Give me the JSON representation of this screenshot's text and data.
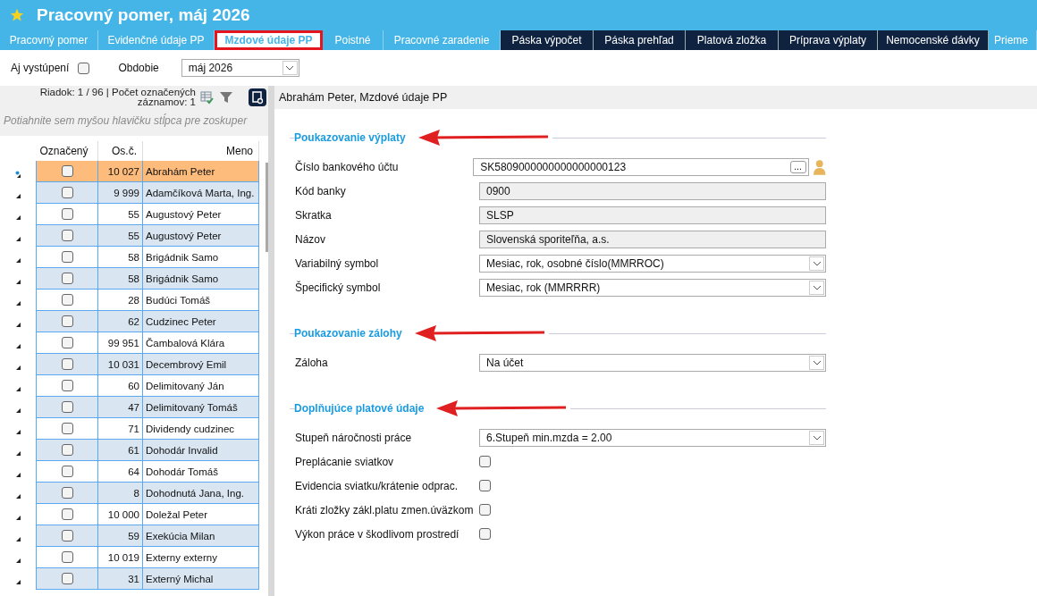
{
  "window": {
    "title": "Pracovný pomer, máj 2026"
  },
  "tabs": [
    {
      "label": "Pracovný pomer",
      "kind": "light",
      "selected": false
    },
    {
      "label": "Evidenčné údaje PP",
      "kind": "light",
      "selected": false
    },
    {
      "label": "Mzdové údaje PP",
      "kind": "light",
      "selected": true
    },
    {
      "label": "Poistné",
      "kind": "light",
      "selected": false
    },
    {
      "label": "Pracovné zaradenie",
      "kind": "light",
      "selected": false
    },
    {
      "label": "Páska výpočet",
      "kind": "dark",
      "selected": false
    },
    {
      "label": "Páska prehľad",
      "kind": "dark",
      "selected": false
    },
    {
      "label": "Platová zložka",
      "kind": "dark",
      "selected": false
    },
    {
      "label": "Príprava výplaty",
      "kind": "dark",
      "selected": false
    },
    {
      "label": "Nemocenské dávky",
      "kind": "dark",
      "selected": false
    },
    {
      "label": "Prieme",
      "kind": "light",
      "selected": false
    }
  ],
  "filters": {
    "include_left_label": "Aj vystúpení",
    "include_left_checked": false,
    "period_label": "Obdobie",
    "period_value": "máj 2026"
  },
  "list_panel": {
    "status": "Riadok: 1 / 96 | Počet označených záznamov: 1",
    "group_hint": "Potiahnite sem myšou hlavičku stĺpca pre zoskuper",
    "columns": [
      "Označený",
      "Os.č.",
      "Meno"
    ],
    "rows": [
      {
        "checked": false,
        "number": "10 027",
        "name": "Abrahám Peter",
        "selected": true
      },
      {
        "checked": false,
        "number": "9 999",
        "name": "Adamčíková Marta, Ing.",
        "selected": false
      },
      {
        "checked": false,
        "number": "55",
        "name": "Augustový Peter",
        "selected": false
      },
      {
        "checked": false,
        "number": "55",
        "name": "Augustový Peter",
        "selected": false
      },
      {
        "checked": false,
        "number": "58",
        "name": "Brigádnik Samo",
        "selected": false
      },
      {
        "checked": false,
        "number": "58",
        "name": "Brigádnik Samo",
        "selected": false
      },
      {
        "checked": false,
        "number": "28",
        "name": "Budúci Tomáš",
        "selected": false
      },
      {
        "checked": false,
        "number": "62",
        "name": "Cudzinec Peter",
        "selected": false
      },
      {
        "checked": false,
        "number": "99 951",
        "name": "Čambalová Klára",
        "selected": false
      },
      {
        "checked": false,
        "number": "10 031",
        "name": "Decembrový Emil",
        "selected": false
      },
      {
        "checked": false,
        "number": "60",
        "name": "Delimitovaný Ján",
        "selected": false
      },
      {
        "checked": false,
        "number": "47",
        "name": "Delimitovaný Tomáš",
        "selected": false
      },
      {
        "checked": false,
        "number": "71",
        "name": "Dividendy cudzinec",
        "selected": false
      },
      {
        "checked": false,
        "number": "61",
        "name": "Dohodár Invalid",
        "selected": false
      },
      {
        "checked": false,
        "number": "64",
        "name": "Dohodár Tomáš",
        "selected": false
      },
      {
        "checked": false,
        "number": "8",
        "name": "Dohodnutá Jana, Ing.",
        "selected": false
      },
      {
        "checked": false,
        "number": "10 000",
        "name": "Doležal Peter",
        "selected": false
      },
      {
        "checked": false,
        "number": "59",
        "name": "Exekúcia Milan",
        "selected": false
      },
      {
        "checked": false,
        "number": "10 019",
        "name": "Externy externy",
        "selected": false
      },
      {
        "checked": false,
        "number": "31",
        "name": "Externý Michal",
        "selected": false
      }
    ]
  },
  "detail": {
    "title": "Abrahám Peter, Mzdové údaje PP",
    "sections": [
      {
        "title": "Poukazovanie výplaty",
        "annotated": true,
        "fields": [
          {
            "kind": "text",
            "label": "Číslo bankového účtu",
            "value": "SK5809000000000000000123",
            "button": "..."
          },
          {
            "kind": "readonly",
            "label": "Kód banky",
            "value": "0900"
          },
          {
            "kind": "readonly",
            "label": "Skratka",
            "value": "SLSP"
          },
          {
            "kind": "readonly",
            "label": "Názov",
            "value": "Slovenská sporiteľňa, a.s."
          },
          {
            "kind": "select",
            "label": "Variabilný symbol",
            "value": "Mesiac, rok, osobné číslo(MMRROC)"
          },
          {
            "kind": "select",
            "label": "Špecifický symbol",
            "value": "Mesiac, rok (MMRRRR)"
          }
        ]
      },
      {
        "title": "Poukazovanie zálohy",
        "annotated": true,
        "fields": [
          {
            "kind": "select",
            "label": "Záloha",
            "value": "Na účet"
          }
        ]
      },
      {
        "title": "Doplňujúce platové údaje",
        "annotated": true,
        "fields": [
          {
            "kind": "select",
            "label": "Stupeň náročnosti práce",
            "value": "6.Stupeň min.mzda = 2.00"
          },
          {
            "kind": "checkbox",
            "label": "Preplácanie sviatkov",
            "checked": false
          },
          {
            "kind": "checkbox",
            "label": "Evidencia sviatku/krátenie odprac.",
            "checked": false
          },
          {
            "kind": "checkbox",
            "label": "Kráti zložky zákl.platu zmen.úväzkom",
            "checked": false
          },
          {
            "kind": "checkbox",
            "label": "Výkon práce v škodlivom prostredí",
            "checked": false
          }
        ]
      }
    ]
  }
}
